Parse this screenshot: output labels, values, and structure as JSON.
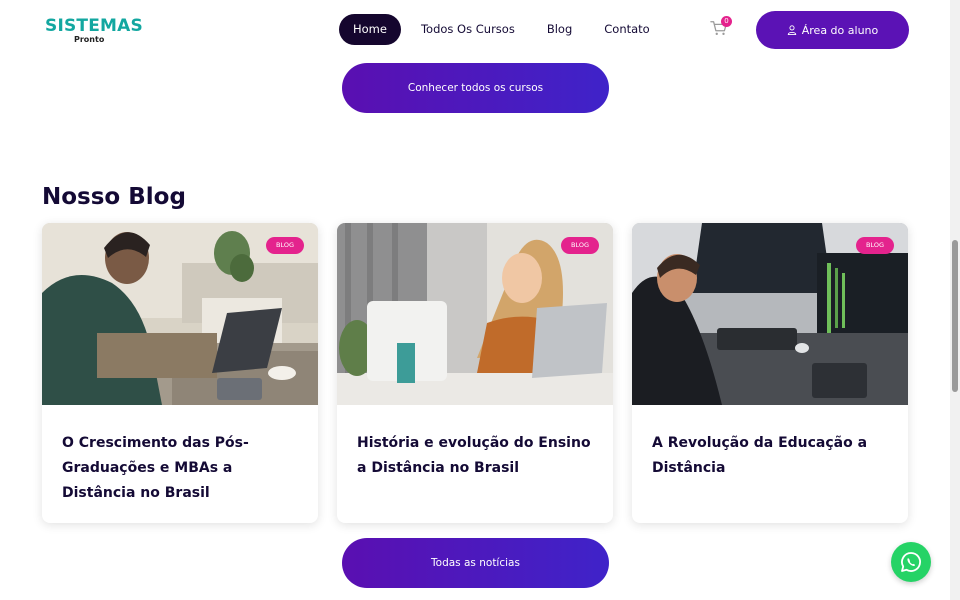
{
  "brand": {
    "name": "SISTEMAS",
    "tagline": "Pronto"
  },
  "nav": [
    {
      "label": "Home",
      "active": true
    },
    {
      "label": "Todos Os Cursos"
    },
    {
      "label": "Blog"
    },
    {
      "label": "Contato"
    }
  ],
  "cart": {
    "count": "0",
    "icon": "cart-icon"
  },
  "student_area": {
    "label": "Área do aluno",
    "icon": "user-icon"
  },
  "courses_button": {
    "label": "Conhecer todos os cursos"
  },
  "blog": {
    "title": "Nosso Blog",
    "posts": [
      {
        "badge": "BLOG",
        "title": "O Crescimento das Pós-Graduações e MBAs a Distância no Brasil"
      },
      {
        "badge": "BLOG",
        "title": "História e evolução do Ensino a Distância no Brasil"
      },
      {
        "badge": "BLOG",
        "title": "A Revolução da Educação a Distância"
      }
    ]
  },
  "news_button": {
    "label": "Todas as notícias"
  },
  "colors": {
    "brand_teal": "#13a7a0",
    "primary_purple": "#5b12b5",
    "badge_pink": "#e4238d",
    "whatsapp_green": "#25d366"
  }
}
